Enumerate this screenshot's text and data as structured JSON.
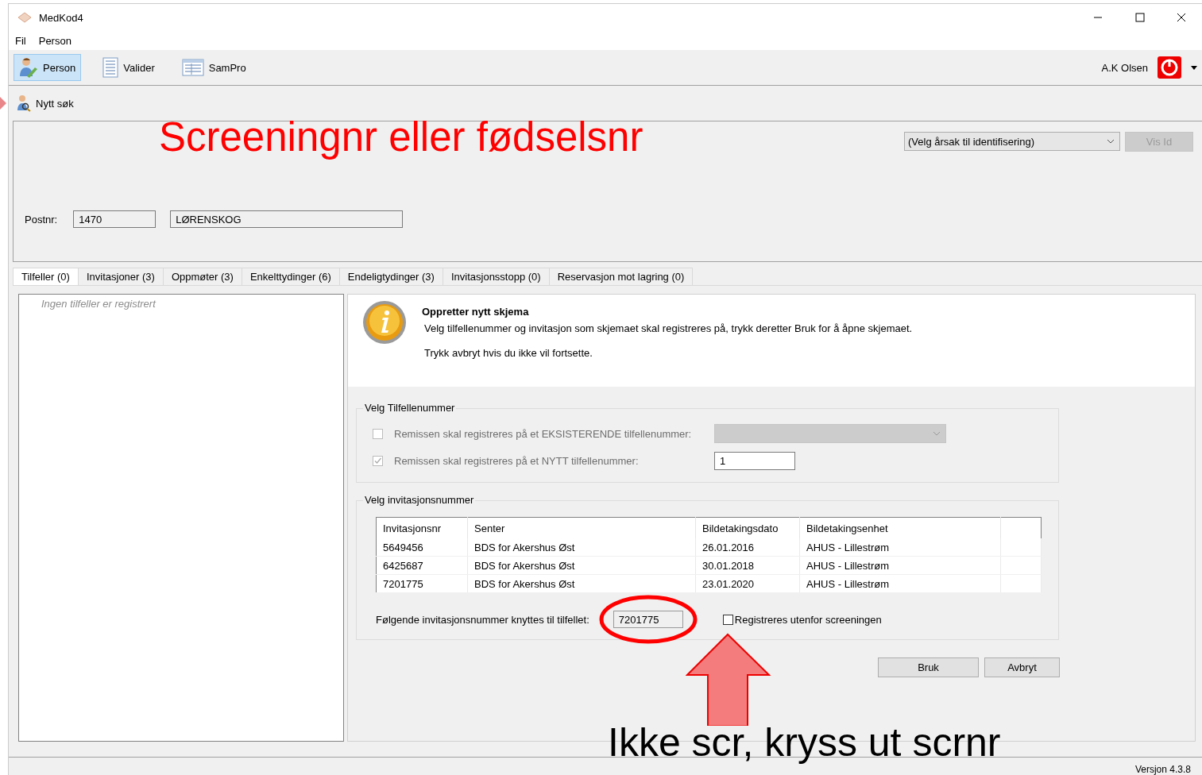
{
  "window": {
    "title": "MedKod4"
  },
  "menu": [
    {
      "label": "Fil"
    },
    {
      "label": "Person"
    }
  ],
  "toolbar": {
    "buttons": [
      {
        "label": "Person",
        "selected": true,
        "kind": "person"
      },
      {
        "label": "Valider",
        "selected": false,
        "kind": "list"
      },
      {
        "label": "SamPro",
        "selected": false,
        "kind": "grid"
      }
    ],
    "user": "A.K Olsen"
  },
  "search_bar": {
    "new_search": "Nytt søk"
  },
  "search_panel": {
    "reason_select": "(Velg årsak til identifisering)",
    "show_id_button": {
      "label": "Vis Id",
      "disabled": true
    },
    "postnr_label": "Postnr:",
    "postnr": "1470",
    "place": "LØRENSKOG"
  },
  "tabs": [
    {
      "label": "Tilfeller (0)",
      "selected": true
    },
    {
      "label": "Invitasjoner (3)",
      "selected": false
    },
    {
      "label": "Oppmøter (3)",
      "selected": false
    },
    {
      "label": "Enkelttydinger (6)",
      "selected": false
    },
    {
      "label": "Endeligtydinger (3)",
      "selected": false
    },
    {
      "label": "Invitasjonsstopp (0)",
      "selected": false
    },
    {
      "label": "Reservasjon mot lagring (0)",
      "selected": false
    }
  ],
  "case_list": {
    "empty_text": "Ingen tilfeller er registrert"
  },
  "info": {
    "title": "Oppretter nytt skjema",
    "text": "Velg tilfellenummer og invitasjon som skjemaet skal registreres på, trykk deretter Bruk for å åpne skjemaet.",
    "hint": "Trykk avbryt hvis du ikke vil fortsette."
  },
  "case_number": {
    "legend": "Velg Tilfellenummer",
    "options": [
      {
        "kind": "select",
        "label": "Remissen skal registreres på et EKSISTERENDE tilfellenummer:",
        "checked": false,
        "disabled": true
      },
      {
        "kind": "input",
        "label": "Remissen skal registreres på et NYTT tilfellenummer:",
        "checked": true,
        "disabled": true,
        "value": "1"
      }
    ]
  },
  "invitation": {
    "legend": "Velg invitasjonsnummer",
    "table": {
      "columns": [
        "Invitasjonsnr",
        "Senter",
        "Bildetakingsdato",
        "Bildetakingsenhet"
      ],
      "rows": [
        [
          "5649456",
          "BDS for Akershus Øst",
          "26.01.2016",
          "AHUS - Lillestrøm"
        ],
        [
          "6425687",
          "BDS for Akershus Øst",
          "30.01.2018",
          "AHUS - Lillestrøm"
        ],
        [
          "7201775",
          "BDS for Akershus Øst",
          "23.01.2020",
          "AHUS - Lillestrøm"
        ]
      ]
    },
    "linked_label": "Følgende invitasjonsnummer knyttes til tilfellet:",
    "linked_value": "7201775",
    "outside_checkbox": {
      "label": "Registreres utenfor screeningen",
      "checked": false
    }
  },
  "buttons": [
    {
      "label": "Bruk"
    },
    {
      "label": "Avbryt"
    }
  ],
  "status_bar": {
    "version": "Versjon 4.3.8"
  },
  "annotations": {
    "heading": "Screeningnr eller fødselsnr",
    "note": "Ikke scr, kryss ut scrnr"
  }
}
